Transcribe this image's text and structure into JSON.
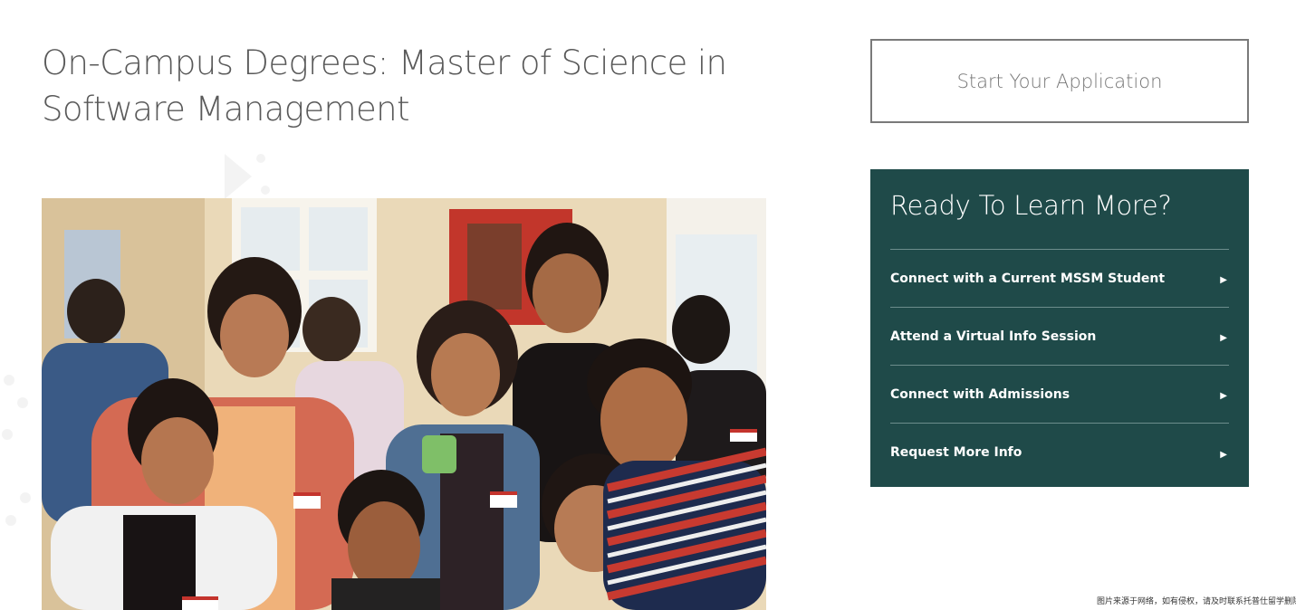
{
  "page": {
    "title": "On-Campus Degrees: Master of Science in Software Management"
  },
  "photo": {
    "description_icon": "group-photo",
    "colors": {
      "wall": "#e9dcc2",
      "accent": "#c4342d"
    }
  },
  "apply": {
    "label": "Start Your Application"
  },
  "learn_more": {
    "heading": "Ready To Learn More?",
    "background": "#1f4a49",
    "items": [
      {
        "label": "Connect with a Current MSSM Student",
        "icon": "play-arrow-icon",
        "arrow": "▶"
      },
      {
        "label": "Attend a Virtual Info Session",
        "icon": "play-arrow-icon",
        "arrow": "▶"
      },
      {
        "label": "Connect with Admissions",
        "icon": "play-arrow-icon",
        "arrow": "▶"
      },
      {
        "label": "Request More Info",
        "icon": "play-arrow-icon",
        "arrow": "▶"
      }
    ]
  },
  "footnote": {
    "text": "图片来源于网络，如有侵权，请及时联系托普仕留学删除"
  }
}
